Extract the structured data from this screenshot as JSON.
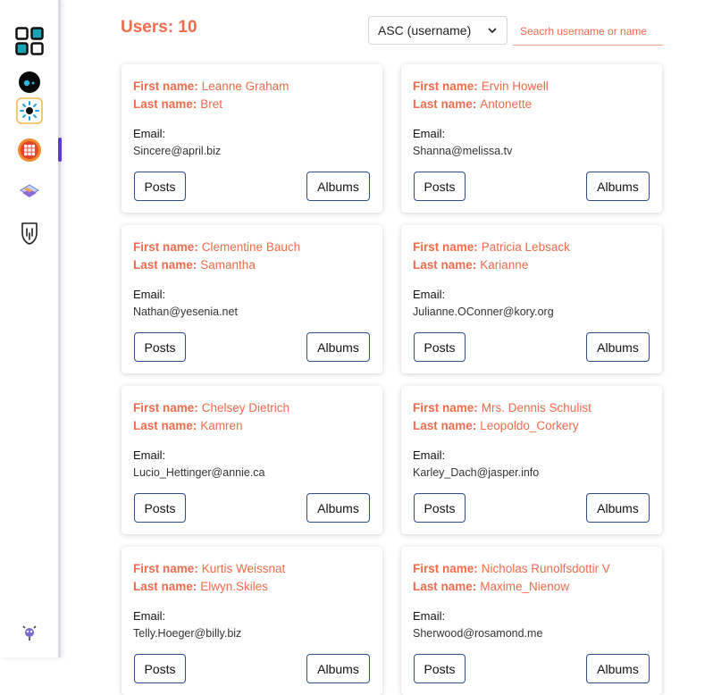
{
  "sidebar": {
    "items": [
      {
        "name": "apps-grid-icon"
      },
      {
        "name": "blue-dot-app-icon"
      },
      {
        "name": "sun-app-icon"
      },
      {
        "name": "orange-grid-app-icon"
      },
      {
        "name": "stack-app-icon"
      },
      {
        "name": "hand-app-icon"
      },
      {
        "name": "settings-bot-icon"
      }
    ]
  },
  "header": {
    "users_count": "Users: 10",
    "sort_selected": "ASC (username)",
    "search_placeholder": "Seacrh username or name"
  },
  "labels": {
    "first_name": "First name:",
    "last_name": "Last name:",
    "email": "Email:",
    "posts": "Posts",
    "albums": "Albums"
  },
  "users": [
    {
      "first": "Leanne Graham",
      "last": "Bret",
      "email": "Sincere@april.biz"
    },
    {
      "first": "Ervin Howell",
      "last": "Antonette",
      "email": "Shanna@melissa.tv"
    },
    {
      "first": "Clementine Bauch",
      "last": "Samantha",
      "email": "Nathan@yesenia.net"
    },
    {
      "first": "Patricia Lebsack",
      "last": "Karianne",
      "email": "Julianne.OConner@kory.org"
    },
    {
      "first": "Chelsey Dietrich",
      "last": "Kamren",
      "email": "Lucio_Hettinger@annie.ca"
    },
    {
      "first": "Mrs. Dennis Schulist",
      "last": "Leopoldo_Corkery",
      "email": "Karley_Dach@jasper.info"
    },
    {
      "first": "Kurtis Weissnat",
      "last": "Elwyn.Skiles",
      "email": "Telly.Hoeger@billy.biz"
    },
    {
      "first": "Nicholas Runolfsdottir V",
      "last": "Maxime_Nienow",
      "email": "Sherwood@rosamond.me"
    }
  ],
  "colors": {
    "accent": "#f26b4b",
    "button_border": "#2f4c8f",
    "active_bar": "#5b3ad6"
  }
}
